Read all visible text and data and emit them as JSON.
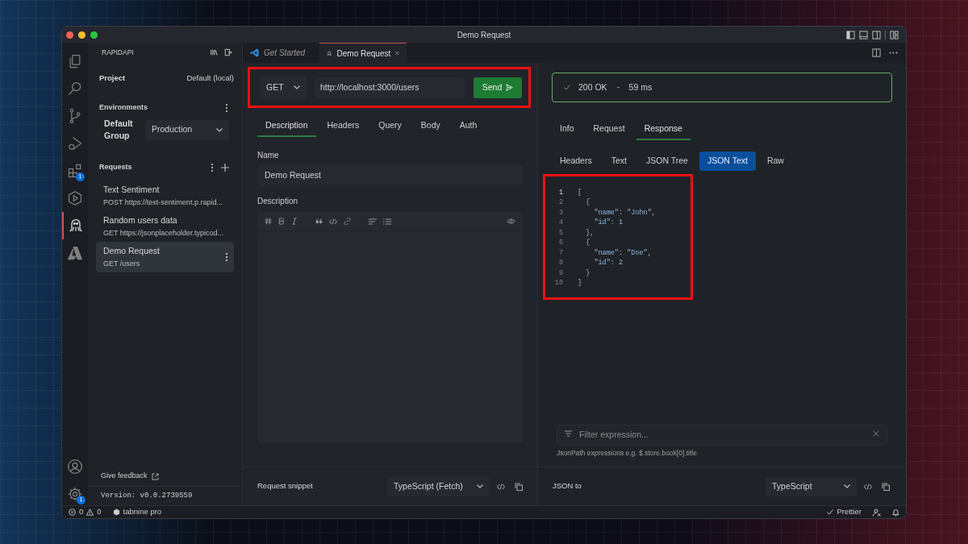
{
  "window": {
    "title": "Demo Request"
  },
  "activity_bar": {
    "items": [
      {
        "selected": false
      },
      {
        "selected": false
      },
      {
        "selected": false
      },
      {
        "selected": false
      },
      {
        "selected": false,
        "badge": "1"
      },
      {
        "selected": false
      },
      {
        "selected": true
      },
      {
        "selected": false
      }
    ],
    "settings_badge": "1"
  },
  "sidebar": {
    "title": "RAPIDAPI",
    "project": {
      "label": "Project",
      "value": "Default (local)"
    },
    "environments": {
      "title": "Environments",
      "group_label": "Default Group",
      "value": "Production"
    },
    "requests": {
      "title": "Requests",
      "items": [
        {
          "name": "Text Sentiment",
          "detail": "POST https://text-sentiment.p.rapid...",
          "selected": false
        },
        {
          "name": "Random users data",
          "detail": "GET https://jsonplaceholder.typicod...",
          "selected": false
        },
        {
          "name": "Demo Request",
          "detail": "GET /users",
          "selected": true
        }
      ]
    },
    "feedback": "Give feedback",
    "version": "Version: v0.0.2739559"
  },
  "tabs": [
    {
      "label": "Get Started",
      "selected": false,
      "preview": true
    },
    {
      "label": "Demo Request",
      "selected": true,
      "preview": false
    }
  ],
  "request": {
    "highlighted": true,
    "method": "GET",
    "url": "http://localhost:3000/users",
    "send": "Send",
    "tabs": [
      {
        "label": "Description",
        "selected": true
      },
      {
        "label": "Headers",
        "selected": false
      },
      {
        "label": "Query",
        "selected": false
      },
      {
        "label": "Body",
        "selected": false
      },
      {
        "label": "Auth",
        "selected": false
      }
    ],
    "name_label": "Name",
    "name_value": "Demo Request",
    "description_label": "Description",
    "snippet": {
      "label": "Request snippet",
      "language": "TypeScript (Fetch)"
    }
  },
  "response": {
    "status": "200 OK",
    "time": "59 ms",
    "tabs": [
      {
        "label": "Info",
        "selected": false
      },
      {
        "label": "Request",
        "selected": false
      },
      {
        "label": "Response",
        "selected": true
      }
    ],
    "views": [
      {
        "label": "Headers",
        "selected": false
      },
      {
        "label": "Text",
        "selected": false
      },
      {
        "label": "JSON Tree",
        "selected": false
      },
      {
        "label": "JSON Text",
        "selected": true
      },
      {
        "label": "Raw",
        "selected": false
      }
    ],
    "code": {
      "highlighted": true,
      "lines": [
        {
          "number": "1",
          "text": "[",
          "current": true
        },
        {
          "number": "2",
          "text": "  {",
          "current": false
        },
        {
          "number": "3",
          "text": "    \"name\": \"John\",",
          "current": false
        },
        {
          "number": "4",
          "text": "    \"id\": 1",
          "current": false
        },
        {
          "number": "5",
          "text": "  },",
          "current": false
        },
        {
          "number": "6",
          "text": "  {",
          "current": false
        },
        {
          "number": "7",
          "text": "    \"name\": \"Doe\",",
          "current": false
        },
        {
          "number": "8",
          "text": "    \"id\": 2",
          "current": false
        },
        {
          "number": "9",
          "text": "  }",
          "current": false
        },
        {
          "number": "10",
          "text": "]",
          "current": false
        }
      ]
    },
    "filter": {
      "placeholder": "Filter expression..."
    },
    "hint": "JsonPath expressions e.g. $.store.book[0].title",
    "convert": {
      "label": "JSON to",
      "language": "TypeScript"
    }
  },
  "status_bar": {
    "errors": "0",
    "warnings": "0",
    "tabnine": "tabnine pro",
    "prettier": "Prettier"
  }
}
